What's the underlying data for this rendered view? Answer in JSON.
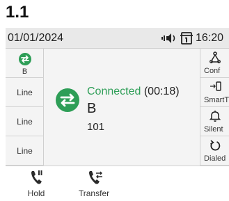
{
  "section_title": "1.1",
  "status_bar": {
    "date": "01/01/2024",
    "time": "16:20",
    "icons": [
      "speaker-icon",
      "headset-icon"
    ]
  },
  "line_keys": [
    {
      "label": "B",
      "icon": "call-transfer-icon",
      "active": true,
      "color": "#2e9e57"
    },
    {
      "label": "Line"
    },
    {
      "label": "Line"
    },
    {
      "label": "Line"
    }
  ],
  "call": {
    "state": "Connected",
    "duration": "(00:18)",
    "name": "B",
    "number": "101",
    "icon": "call-transfer-icon",
    "state_color": "#2e9e57"
  },
  "side_keys": [
    {
      "label": "Conf",
      "icon": "conference-icon"
    },
    {
      "label": "SmartTransfer",
      "icon": "smart-transfer-icon"
    },
    {
      "label": "Silent",
      "icon": "bell-silent-icon"
    },
    {
      "label": "Dialed",
      "icon": "redial-icon"
    }
  ],
  "softkeys": [
    {
      "label": "Hold",
      "icon": "phone-hold-icon"
    },
    {
      "label": "Transfer",
      "icon": "phone-transfer-icon"
    }
  ]
}
